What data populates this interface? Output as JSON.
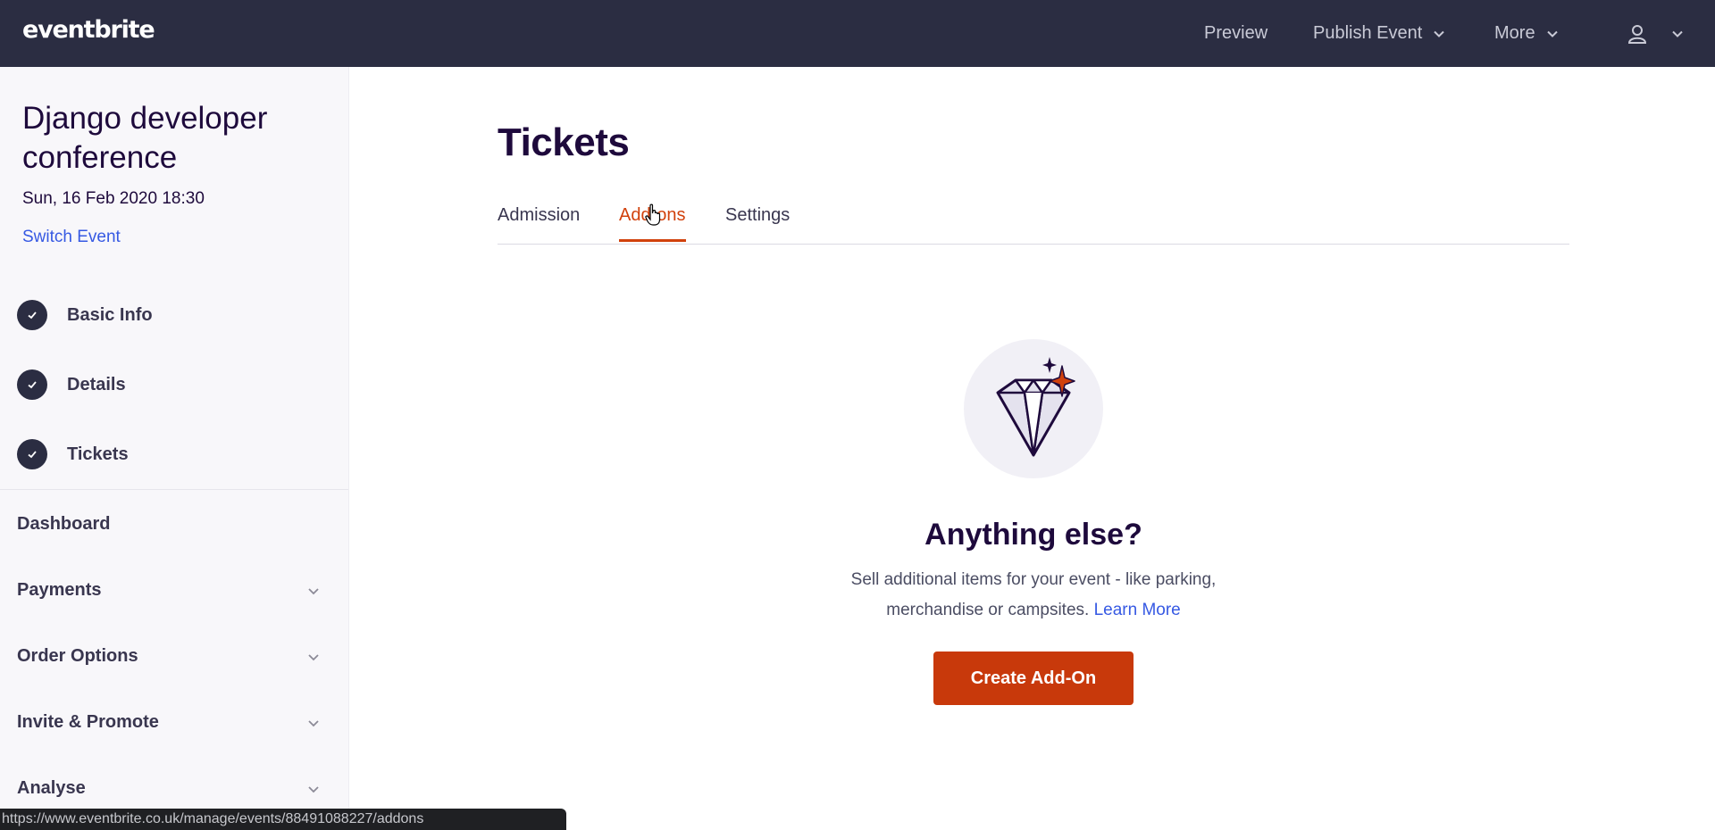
{
  "topbar": {
    "logo": "eventbrite",
    "preview_label": "Preview",
    "publish_label": "Publish Event",
    "more_label": "More",
    "bg_color": "#2b2d42"
  },
  "sidebar": {
    "event_title": "Django developer conference",
    "event_date": "Sun, 16 Feb 2020 18:30",
    "switch_event": "Switch Event",
    "steps": [
      {
        "label": "Basic Info",
        "done": true
      },
      {
        "label": "Details",
        "done": true
      },
      {
        "label": "Tickets",
        "done": true
      }
    ],
    "items": [
      {
        "label": "Dashboard",
        "expandable": false
      },
      {
        "label": "Payments",
        "expandable": true
      },
      {
        "label": "Order Options",
        "expandable": true
      },
      {
        "label": "Invite & Promote",
        "expandable": true
      },
      {
        "label": "Analyse",
        "expandable": true
      }
    ]
  },
  "main": {
    "title": "Tickets",
    "tabs": [
      {
        "label": "Admission",
        "active": false
      },
      {
        "label": "Add-ons",
        "active": true
      },
      {
        "label": "Settings",
        "active": false
      }
    ],
    "empty_state": {
      "icon": "diamond-icon",
      "heading": "Anything else?",
      "description": "Sell additional items for your event - like parking, merchandise or campsites.",
      "learn_more": "Learn More",
      "button": "Create Add-On"
    }
  },
  "statusbar": {
    "url": "https://www.eventbrite.co.uk/manage/events/88491088227/addons"
  },
  "colors": {
    "accent": "#d1410c",
    "button": "#c8390b",
    "link": "#3659e3"
  }
}
